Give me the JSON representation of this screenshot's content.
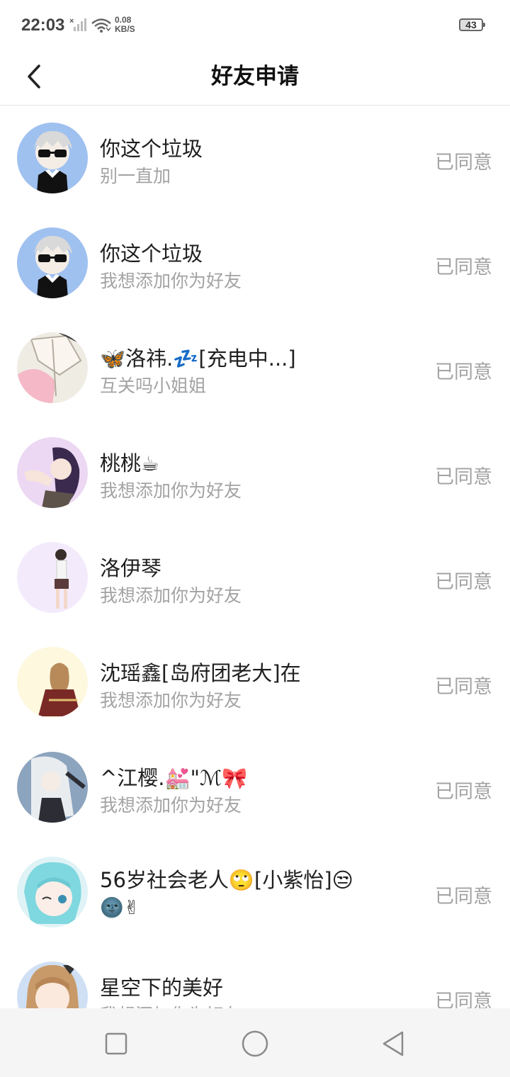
{
  "status_bar": {
    "time": "22:03",
    "speed_value": "0.08",
    "speed_unit": "KB/S",
    "battery": "43"
  },
  "header": {
    "title": "好友申请"
  },
  "requests": [
    {
      "name": "你这个垃圾",
      "message": "别一直加",
      "status": "已同意",
      "avatar_color": "#9fc1f0"
    },
    {
      "name": "你这个垃圾",
      "message": "我想添加你为好友",
      "status": "已同意",
      "avatar_color": "#9fc1f0"
    },
    {
      "name": "🦋洛祎.💤[充电中...]",
      "message": "互关吗小姐姐",
      "status": "已同意",
      "avatar_color": "#f4c9d4"
    },
    {
      "name": "桃桃☕",
      "message": "我想添加你为好友",
      "status": "已同意",
      "avatar_color": "#e9d2f2"
    },
    {
      "name": "洛伊琴",
      "message": "我想添加你为好友",
      "status": "已同意",
      "avatar_color": "#f1e8fb"
    },
    {
      "name": "沈瑶鑫[岛府团老大]在",
      "message": "我想添加你为好友",
      "status": "已同意",
      "avatar_color": "#fdf7dc"
    },
    {
      "name": "^江樱.💒\"ℳ🎀",
      "message": "我想添加你为好友",
      "status": "已同意",
      "avatar_color": "#8aa3bd"
    },
    {
      "name": "56岁社会老人🙄[小紫怡]😒",
      "name_line2": "🌚✌",
      "message": "",
      "status": "已同意",
      "avatar_color": "#7fd7df"
    },
    {
      "name": "星空下的美好",
      "message": "我想添加你为好友",
      "status": "已同意",
      "avatar_color": "#f6d9b8"
    }
  ]
}
